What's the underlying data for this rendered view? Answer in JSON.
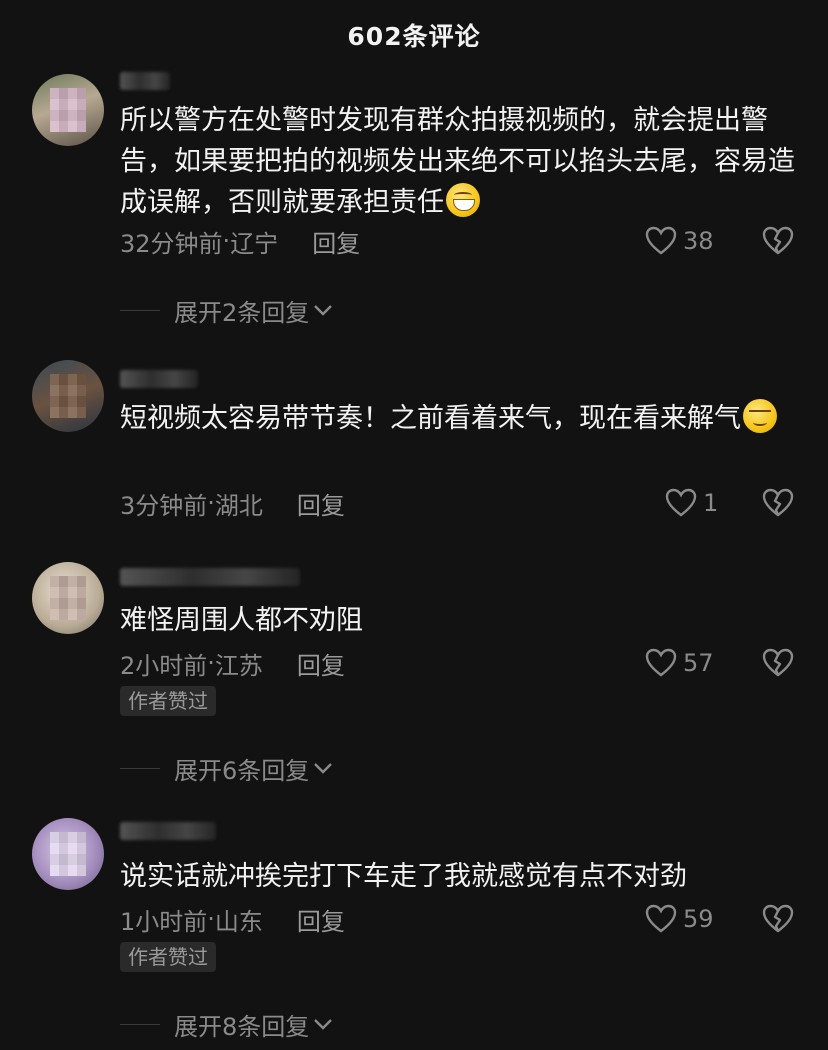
{
  "header": {
    "title": "602条评论"
  },
  "comments": [
    {
      "text": "所以警方在处警时发现有群众拍摄视频的，就会提出警告，如果要把拍的视频发出来绝不可以掐头去尾，容易造成误解，否则就要承担责任",
      "emoji": "grin-icon",
      "time": "32分钟前",
      "location": "辽宁",
      "reply": "回复",
      "likes": "38",
      "expand": "展开2条回复"
    },
    {
      "text": "短视频太容易带节奏！之前看着来气，现在看来解气",
      "emoji": "smirk-icon",
      "time": "3分钟前",
      "location": "湖北",
      "reply": "回复",
      "likes": "1"
    },
    {
      "text": "难怪周围人都不劝阻",
      "time": "2小时前",
      "location": "江苏",
      "reply": "回复",
      "likes": "57",
      "badge": "作者赞过",
      "expand": "展开6条回复"
    },
    {
      "text": "说实话就冲挨完打下车走了我就感觉有点不对劲",
      "time": "1小时前",
      "location": "山东",
      "reply": "回复",
      "likes": "59",
      "badge": "作者赞过",
      "expand": "展开8条回复"
    }
  ],
  "separator": " · ",
  "colors": {
    "background": "#121212",
    "text": "#f2f2f2",
    "meta": "#8a8a8a",
    "badge_bg": "#2a2a2a"
  }
}
